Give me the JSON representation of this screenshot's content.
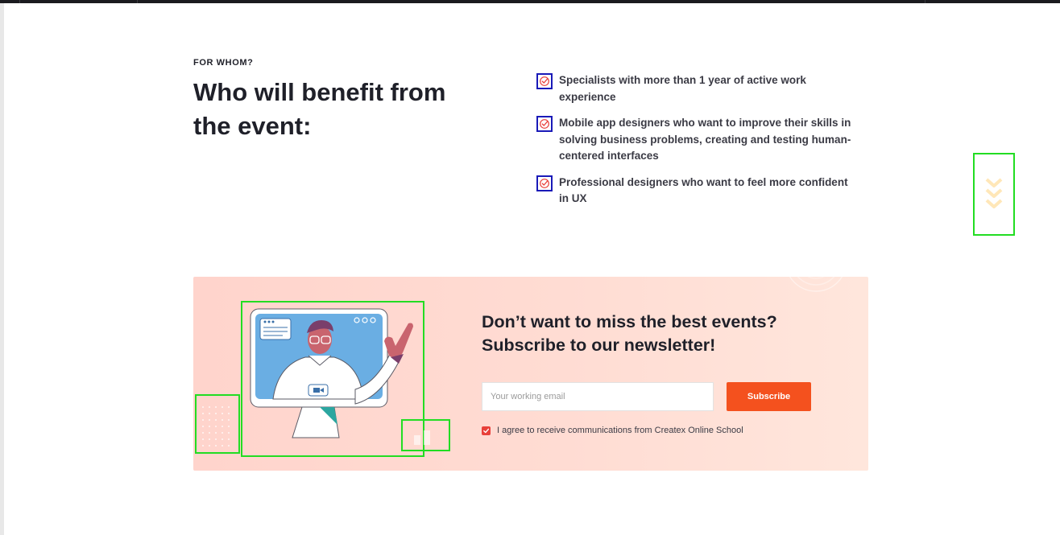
{
  "audience": {
    "eyebrow": "FOR WHOM?",
    "heading": "Who will benefit from the event:",
    "items": [
      {
        "text": "Specialists with more than 1 year of active work experience",
        "icon": "check-circle-icon"
      },
      {
        "text": "Mobile app designers who want to improve their skills in solving business problems, creating and testing human-centered interfaces",
        "icon": "check-circle-icon"
      },
      {
        "text": "Professional designers who want to feel more confident in UX",
        "icon": "check-circle-icon"
      }
    ]
  },
  "scroll_indicator": {
    "icon": "chevron-down-icon"
  },
  "newsletter": {
    "title": "Don’t want to miss the best events? Subscribe to our newsletter!",
    "email_placeholder": "Your working email",
    "email_value": "",
    "subscribe_label": "Subscribe",
    "consent_label": "I agree to receive communications from Createx Online School",
    "consent_checked": true,
    "illustration": "video-call-illustration"
  },
  "colors": {
    "accent": "#f4511e",
    "check_red": "#e8403a",
    "heading": "#1f2029",
    "body_text": "#3b3b45",
    "newsletter_bg": "#ffd8ce",
    "chevron": "#ffe7b8",
    "annotation_green": "#22dd22",
    "annotation_blue": "#1a1ab8"
  }
}
